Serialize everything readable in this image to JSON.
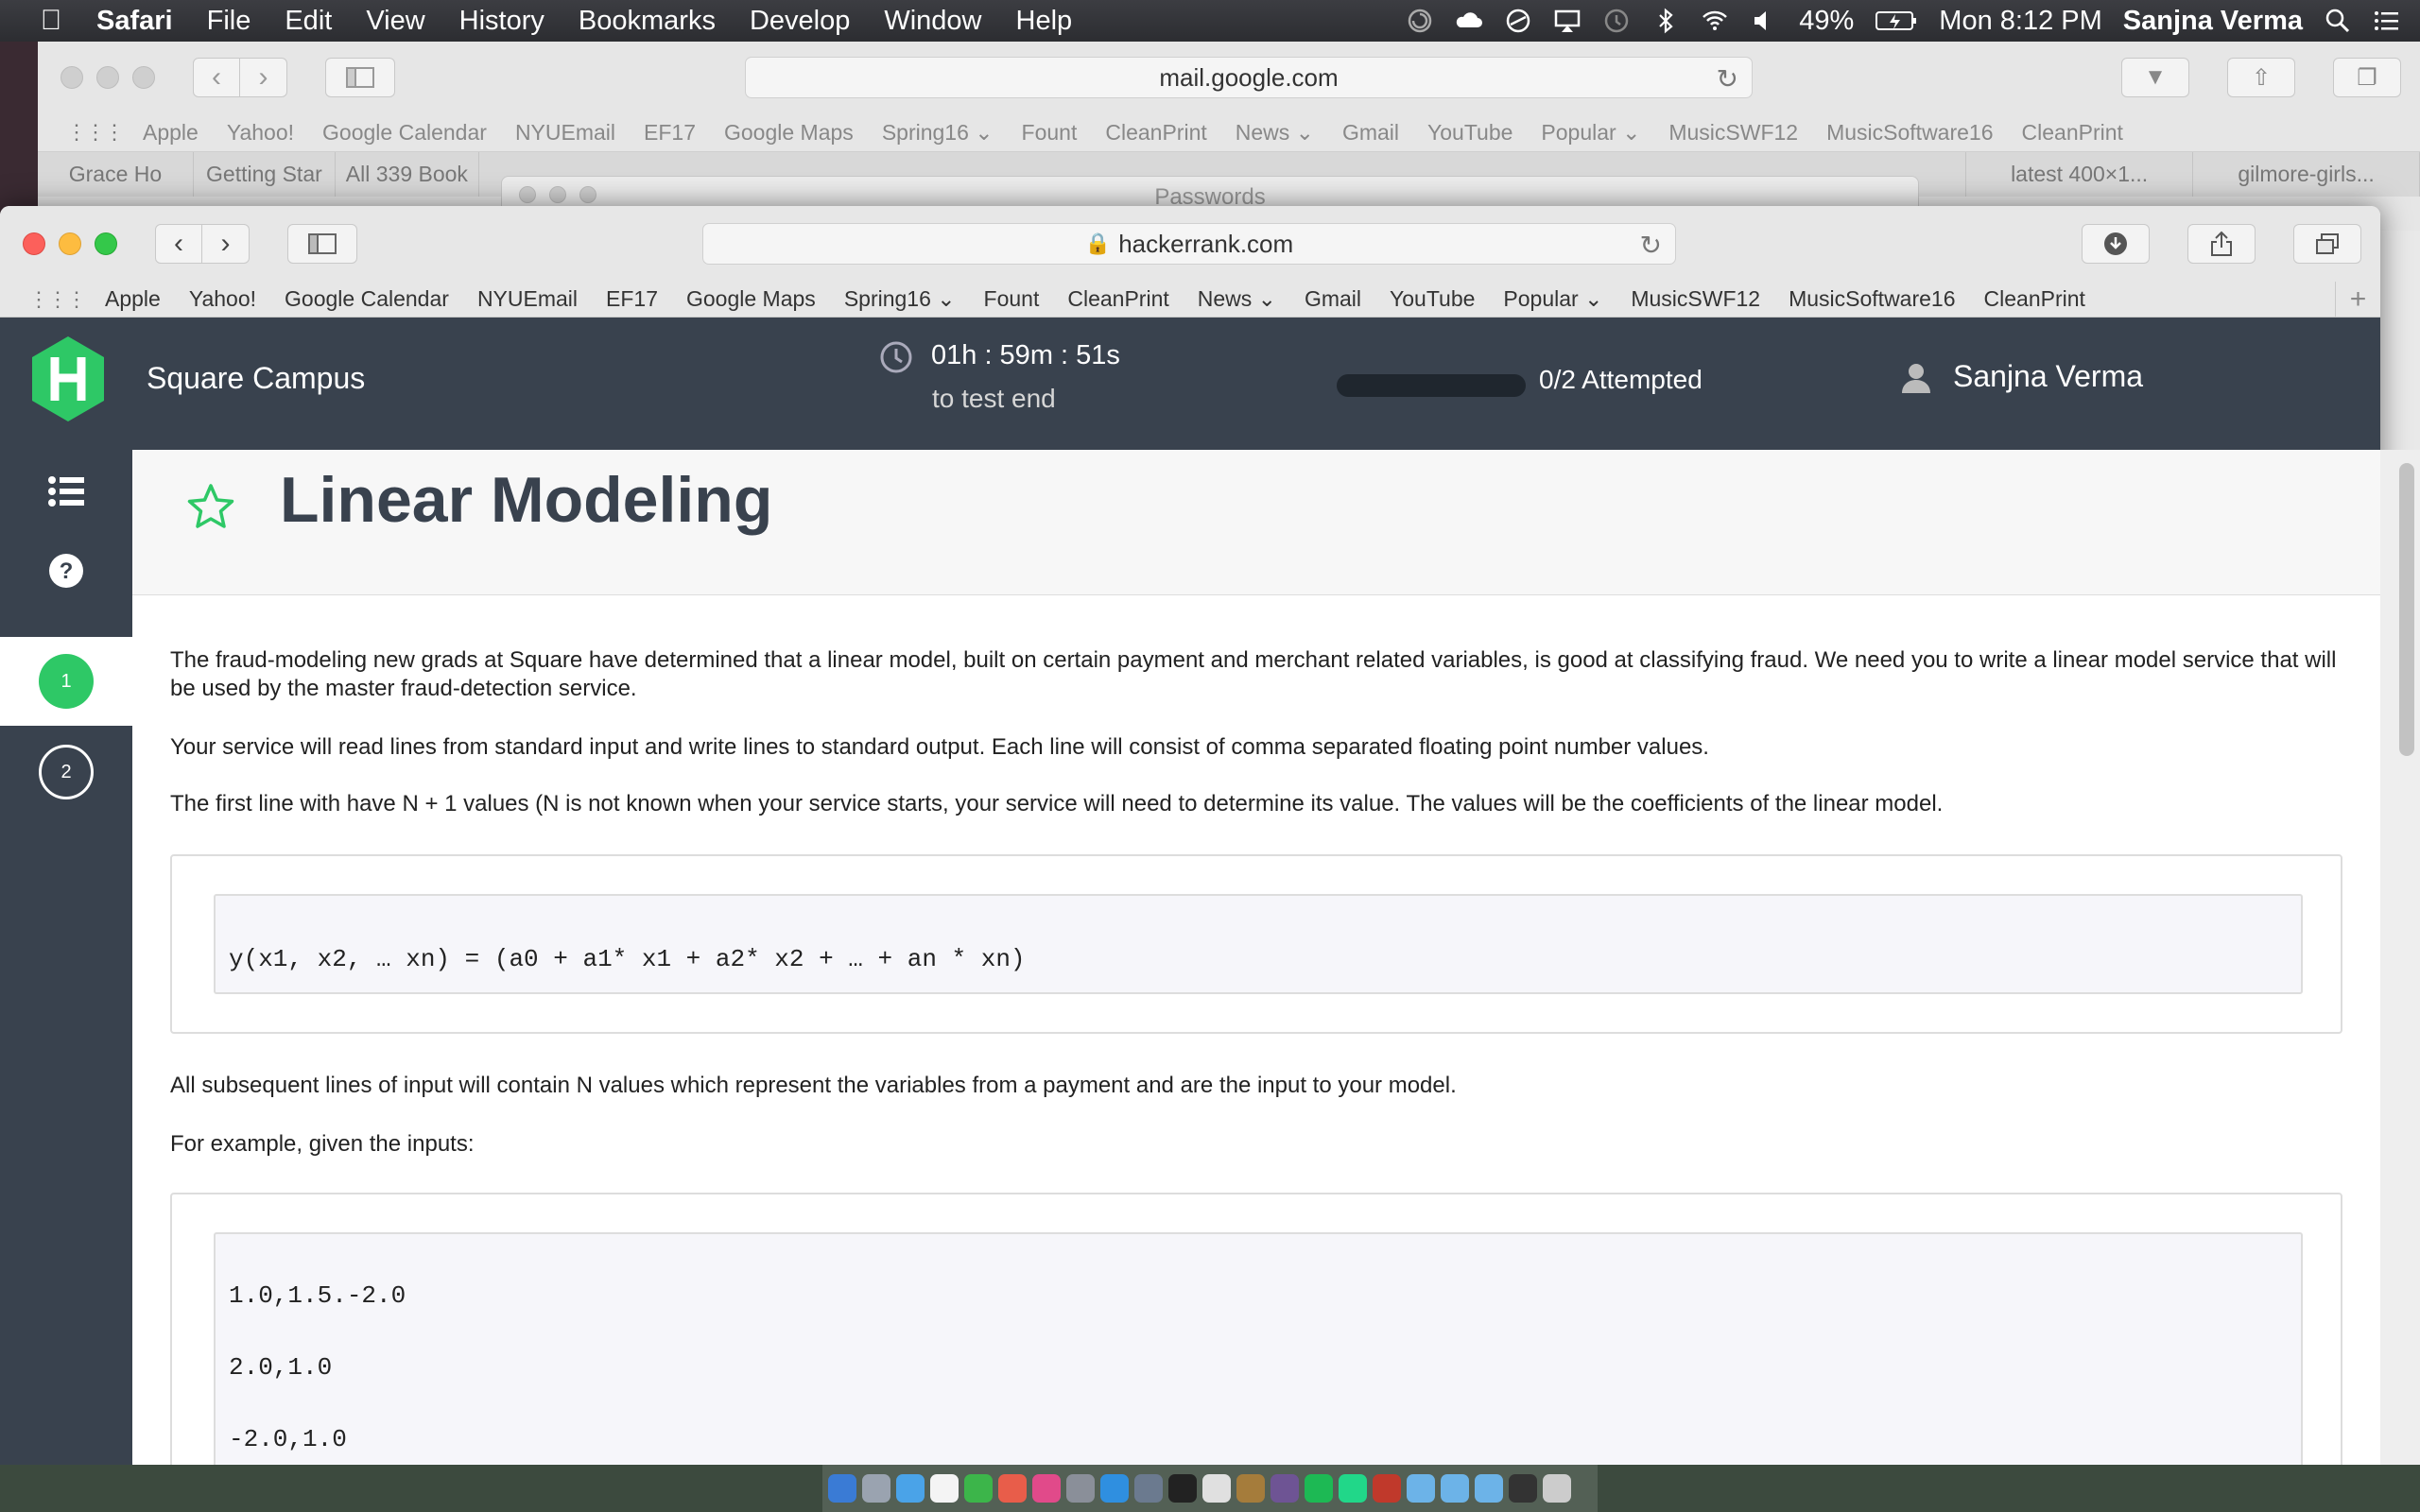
{
  "menubar": {
    "app_name": "Safari",
    "menus": [
      "File",
      "Edit",
      "View",
      "History",
      "Bookmarks",
      "Develop",
      "Window",
      "Help"
    ],
    "battery": "49%",
    "clock": "Mon 8:12 PM",
    "user": "Sanjna Verma"
  },
  "back_window": {
    "url": "mail.google.com",
    "bookmarks": [
      "Apple",
      "Yahoo!",
      "Google Calendar",
      "NYUEmail",
      "EF17",
      "Google Maps",
      "Spring16 ⌄",
      "Fount",
      "CleanPrint",
      "News ⌄",
      "Gmail",
      "YouTube",
      "Popular ⌄",
      "MusicSWF12",
      "MusicSoftware16",
      "CleanPrint"
    ],
    "tabs": [
      "Grace Ho",
      "Getting Star",
      "All 339 Book",
      "",
      "",
      "",
      "",
      "",
      "",
      "latest 400×1...",
      "gilmore-girls..."
    ]
  },
  "passwords_window": {
    "title": "Passwords"
  },
  "front_window": {
    "url": "hackerrank.com",
    "bookmarks": [
      "Apple",
      "Yahoo!",
      "Google Calendar",
      "NYUEmail",
      "EF17",
      "Google Maps",
      "Spring16 ⌄",
      "Fount",
      "CleanPrint",
      "News ⌄",
      "Gmail",
      "YouTube",
      "Popular ⌄",
      "MusicSWF12",
      "MusicSoftware16",
      "CleanPrint"
    ]
  },
  "hackerrank": {
    "logo_letter": "H",
    "campus": "Square Campus",
    "timer": "01h : 59m : 51s",
    "timer_sub": "to test end",
    "attempted": "0/2 Attempted",
    "progress_fraction": 0,
    "username": "Sanjna Verma",
    "questions": [
      "1",
      "2"
    ],
    "active_question": "1",
    "title": "Linear Modeling",
    "paragraphs": [
      "The fraud-modeling new grads at Square have determined that a linear model, built on certain payment and merchant related variables, is good at classifying fraud. We need you to write a linear model service that will be used by the master fraud-detection service.",
      "Your service will read lines from standard input and write lines to standard output. Each line will consist of comma separated floating point number values.",
      "The first line with have N + 1 values (N is not known when your service starts, your service will need to determine its value. The values will be the coefficients of the linear model.",
      "All subsequent lines of input will contain N values which represent the variables from a payment and are the input to your model.",
      "For example, given the inputs:"
    ],
    "formula": "y(x1, x2, … xn) = (a0 + a1* x1 + a2* x2 + … + an * xn)",
    "example_lines": [
      "1.0,1.5.-2.0",
      "2.0,1.0",
      "-2.0,1.0"
    ]
  }
}
